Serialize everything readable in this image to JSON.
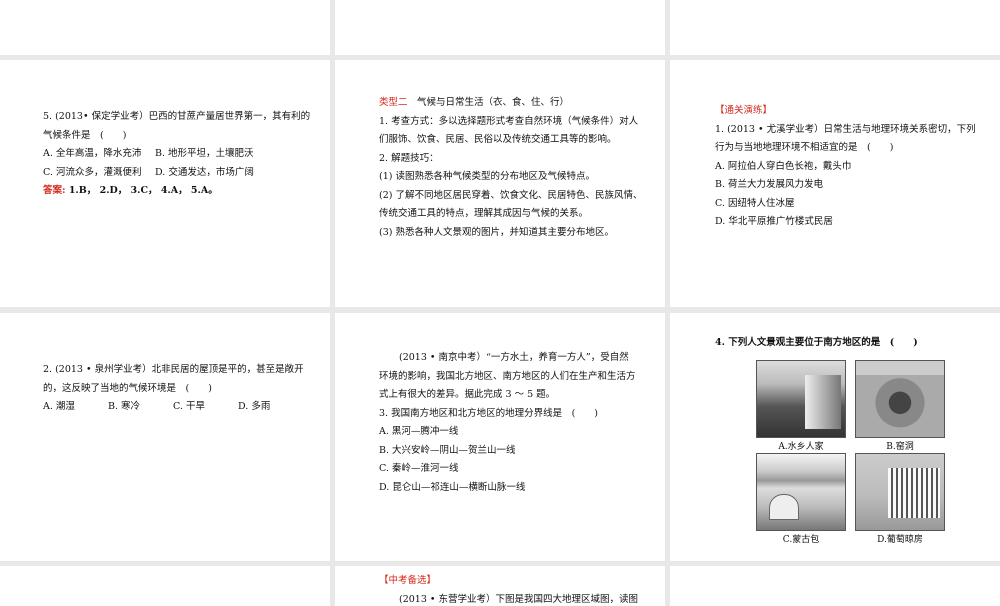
{
  "slide_r2c1": {
    "question": [
      "5. (2013• 保定学业考）巴西的甘蔗产量居世界第一，其有利的",
      "气候条件是　(　　)"
    ],
    "options": [
      "A. 全年高温，降水充沛",
      "B. 地形平坦，土壤肥沃",
      "C. 河流众多，灌溉便利",
      "D. 交通发达，市场广阔"
    ],
    "answer_label": "答案:",
    "answer": " 1.B， 2.D， 3.C， 4.A， 5.A。"
  },
  "slide_r2c2": {
    "type_label": "类型二",
    "type_title": "　气候与日常生活（衣、食、住、行）",
    "lines": [
      "1. 考查方式：多以选择题形式考查自然环境（气候条件）对人",
      "们服饰、饮食、民居、民俗以及传统交通工具等的影响。",
      "2. 解题技巧：",
      "(1) 读图熟悉各种气候类型的分布地区及气候特点。",
      "(2) 了解不同地区居民穿着、饮食文化、民居特色、民族风情、",
      "传统交通工具的特点，理解其成因与气候的关系。",
      "(3) 熟悉各种人文景观的图片，并知道其主要分布地区。"
    ]
  },
  "slide_r2c3": {
    "heading": "【通关演练】",
    "question": [
      "1. (2013 • 尤溪学业考）日常生活与地理环境关系密切，下列",
      "行为与当地地理环境不相适宜的是　(　　)"
    ],
    "options": [
      "A. 阿拉伯人穿白色长袍，戴头巾",
      "B. 荷兰大力发展风力发电",
      "C. 因纽特人住冰屋",
      "D. 华北平原推广竹楼式民居"
    ]
  },
  "slide_r3c1": {
    "question": [
      "2. (2013 • 泉州学业考）北非民居的屋顶是平的，甚至是敞开",
      "的，这反映了当地的气候环境是　(　　)"
    ],
    "options": [
      "A. 潮湿",
      "B. 寒冷",
      "C. 干旱",
      "D. 多雨"
    ]
  },
  "slide_r3c2": {
    "intro": [
      "(2013 • 南京中考）“一方水土，养育一方人”，受自然",
      "环境的影响，我国北方地区、南方地区的人们在生产和生活方",
      "式上有很大的差异。据此完成 3 ～ 5 题。"
    ],
    "question": "3. 我国南方地区和北方地区的地理分界线是　(　　)",
    "options": [
      "A. 黑河—腾冲一线",
      "B. 大兴安岭—阴山—贺兰山一线",
      "C. 秦岭—淮河一线",
      "D. 昆仑山—祁连山—横断山脉一线"
    ]
  },
  "slide_r3c3": {
    "question": "4. 下列人文景观主要位于南方地区的是　(　　)",
    "captions": [
      "A.水乡人家",
      "B.窑洞",
      "C.蒙古包",
      "D.葡萄晾房"
    ]
  },
  "slide_r4c2": {
    "heading": "【中考备选】",
    "line": "(2013 • 东营学业考）下图是我国四大地理区域图，读图"
  }
}
